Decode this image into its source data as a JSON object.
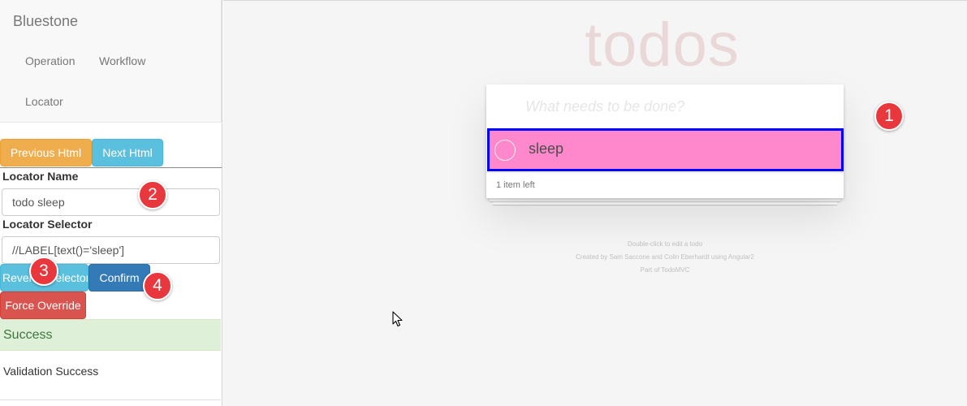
{
  "navbar": {
    "brand": "Bluestone",
    "items": [
      {
        "label": "Operation"
      },
      {
        "label": "Workflow"
      },
      {
        "label": "Locator"
      }
    ]
  },
  "toolbar": {
    "previous_label": "Previous Html",
    "next_label": "Next Html"
  },
  "form": {
    "locator_name_label": "Locator Name",
    "locator_name_value": "todo sleep",
    "locator_selector_label": "Locator Selector",
    "locator_selector_value": "//LABEL[text()='sleep']",
    "reverse_selector_label": "Reverse Selector",
    "confirm_label": "Confirm",
    "force_override_label": "Force Override"
  },
  "status": {
    "alert": "Success",
    "message": "Validation Success"
  },
  "preview": {
    "title": "todos",
    "new_todo_placeholder": "What needs to be done?",
    "todos": [
      {
        "label": "sleep",
        "completed": false,
        "highlighted": true
      }
    ],
    "items_left": "1 item left",
    "info": [
      "Double-click to edit a todo",
      "Created by Sam Saccone and Colin Eberhardt using Angular2",
      "Part of TodoMVC"
    ]
  },
  "badges": [
    "1",
    "2",
    "3",
    "4"
  ],
  "colors": {
    "highlight_fill": "#ff88cc",
    "highlight_border": "#0000ff",
    "badge": "#e8383d",
    "warning": "#f0ad4e",
    "info": "#5bc0de",
    "primary": "#337ab7",
    "danger": "#d9534f",
    "success_bg": "#dff0d8"
  },
  "icons": {
    "cursor": "mouse-pointer-icon",
    "toggle": "todo-toggle-circle-icon"
  }
}
